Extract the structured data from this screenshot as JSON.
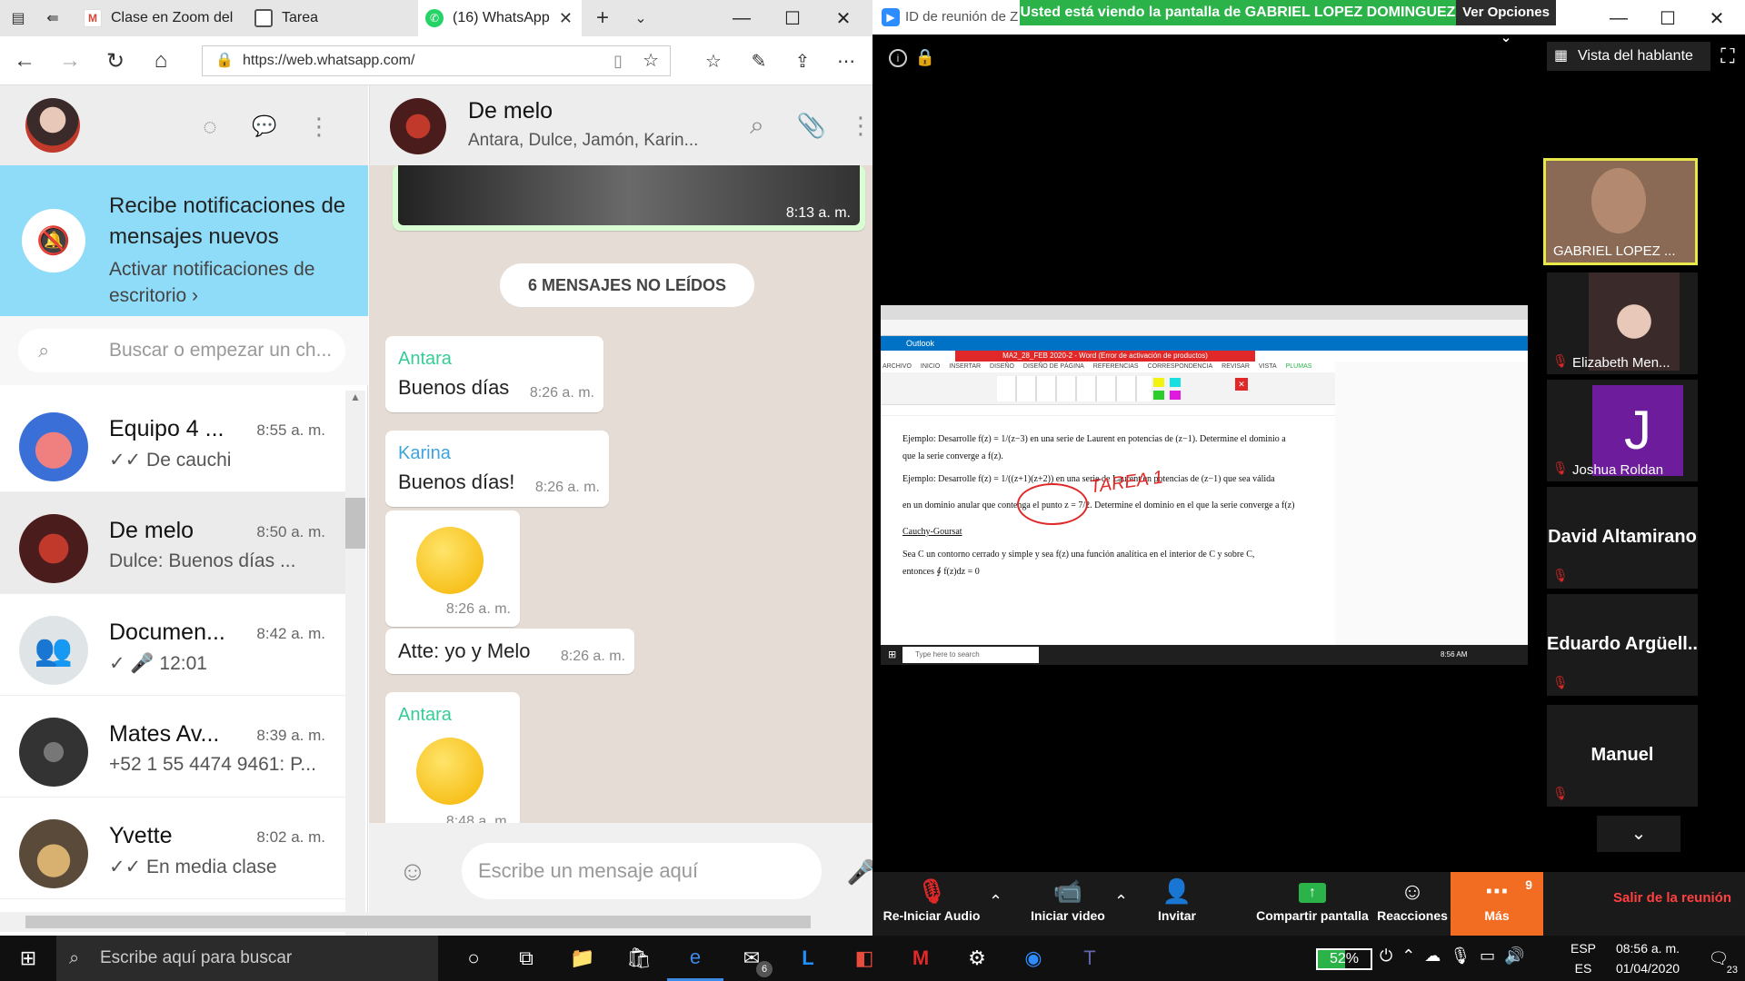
{
  "browser": {
    "tabs": [
      {
        "label": "Clase en Zoom del",
        "icon": "gmail-icon"
      },
      {
        "label": "Tarea",
        "icon": "page-icon"
      },
      {
        "label": "(16) WhatsApp",
        "icon": "whatsapp-icon"
      }
    ],
    "url": "https://web.whatsapp.com/"
  },
  "whatsapp": {
    "notification": {
      "title": "Recibe notificaciones de mensajes nuevos",
      "link": "Activar notificaciones de escritorio ›"
    },
    "search_placeholder": "Buscar o empezar un ch...",
    "chats": [
      {
        "name": "Equipo 4 ...",
        "time": "8:55 a. m.",
        "preview": "✓✓ De cauchi",
        "avatar": "#7b4aa8"
      },
      {
        "name": "De melo",
        "time": "8:50 a. m.",
        "preview": "Dulce: Buenos días ...",
        "avatar": "#6b2b2b"
      },
      {
        "name": "Documen...",
        "time": "8:42 a. m.",
        "preview": "✓ 🎤 12:01",
        "avatar": "#dfe5e7"
      },
      {
        "name": "Mates Av...",
        "time": "8:39 a. m.",
        "preview": "+52 1 55 4474 9461: P...",
        "avatar": "#3c3c3c"
      },
      {
        "name": "Yvette",
        "time": "8:02 a. m.",
        "preview": "✓✓ En media clase",
        "avatar": "#b48a4c"
      }
    ],
    "active_chat": {
      "name": "De melo",
      "members": "Antara, Dulce, Jamón, Karin..."
    },
    "image_time": "8:13 a. m.",
    "unread_label": "6 MENSAJES NO LEÍDOS",
    "messages": [
      {
        "sender": "Antara",
        "text": "Buenos días",
        "time": "8:26 a. m."
      },
      {
        "sender": "Karina",
        "text": "Buenos días!",
        "time": "8:26 a. m."
      },
      {
        "sender": "",
        "text": "😋",
        "time": "8:26 a. m."
      },
      {
        "sender": "",
        "text": "Atte: yo y Melo",
        "time": "8:26 a. m."
      },
      {
        "sender": "Antara",
        "text": "🙂",
        "time": "8:48 a. m."
      }
    ],
    "compose_placeholder": "Escribe un mensaje aquí"
  },
  "zoom": {
    "title": "ID de reunión de Z",
    "banner": "Usted está viendo la pantalla de GABRIEL LOPEZ DOMINGUEZ",
    "options": "Ver Opciones ⌄",
    "speaker_view": "Vista del hablante",
    "shared": {
      "app": "Outlook",
      "doc_title": "MA2_28_FEB 2020-2 - Word (Error de activación de productos)",
      "ribbon_tabs": [
        "ARCHIVO",
        "INICIO",
        "INSERTAR",
        "DISEÑO",
        "DISEÑO DE PÁGINA",
        "REFERENCIAS",
        "CORRESPONDENCIA",
        "REVISAR",
        "VISTA",
        "PLUMAS"
      ],
      "lines": [
        "Ejemplo: Desarrolle f(z) = 1/(z−3) en una serie de Laurent en potencias de (z−1). Determine el dominio a",
        "que la serie converge a f(z).",
        "Ejemplo: Desarrolle f(z) = 1/((z+1)(z+2)) en una serie de Laurent en potencias de (z−1) que sea válida",
        "en un dominio anular que contenga el punto z = 7/2. Determine el dominio en el que la serie converge a f(z)",
        "Cauchy-Goursat",
        "Sea C un contorno cerrado y simple y sea f(z) una función analítica en el interior de C y sobre C,",
        "entonces ∮ f(z)dz = 0"
      ],
      "handwriting": "TAREA 1",
      "taskbar_search": "Type here to search",
      "clock": "8:56 AM"
    },
    "participants": [
      {
        "name": "GABRIEL LOPEZ ...",
        "type": "video",
        "color": "#8a6a55"
      },
      {
        "name": "Elizabeth Men...",
        "type": "video",
        "color": "#3a2a2a"
      },
      {
        "name": "Joshua Roldan",
        "type": "initial",
        "initial": "J",
        "color": "#6d1d9c"
      },
      {
        "name": "David Altamirano",
        "type": "name"
      },
      {
        "name": "Eduardo Argüell...",
        "type": "name"
      },
      {
        "name": "Manuel",
        "type": "name"
      }
    ],
    "controls": [
      {
        "label": "Re-Iniciar Audio",
        "icon": "mic-muted-icon"
      },
      {
        "label": "Iniciar video",
        "icon": "video-off-icon"
      },
      {
        "label": "Invitar",
        "icon": "invite-icon"
      },
      {
        "label": "Compartir pantalla",
        "icon": "share-screen-icon"
      },
      {
        "label": "Reacciones",
        "icon": "reactions-icon"
      },
      {
        "label": "Más",
        "icon": "more-icon",
        "badge": "9"
      }
    ],
    "leave": "Salir de la reunión"
  },
  "taskbar": {
    "search": "Escribe aquí para buscar",
    "battery": "52%",
    "lang1": "ESP",
    "lang2": "ES",
    "time": "08:56 a. m.",
    "date": "01/04/2020",
    "notif": "23",
    "mail_badge": "6"
  }
}
